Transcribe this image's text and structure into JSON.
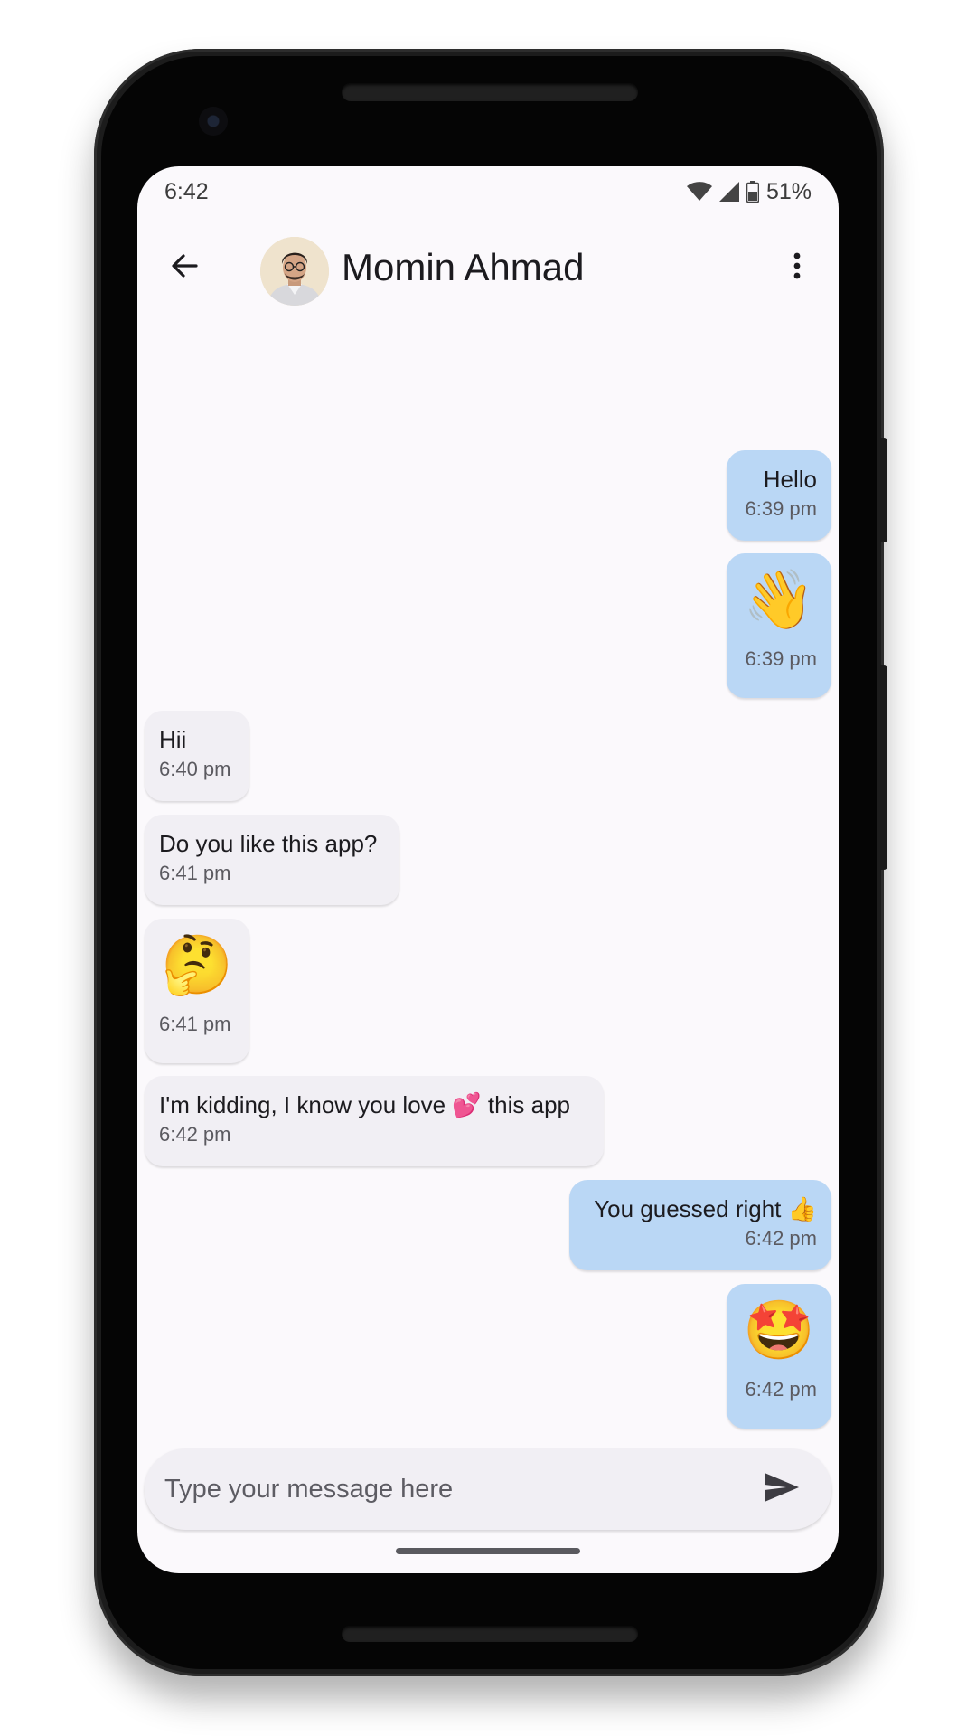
{
  "status_bar": {
    "time": "6:42",
    "battery": "51%",
    "icons": [
      "wifi-icon",
      "signal-icon",
      "battery-icon"
    ]
  },
  "app_bar": {
    "back_icon": "arrow-left-icon",
    "contact_name": "Momin Ahmad",
    "menu_icon": "more-vert-icon"
  },
  "messages": [
    {
      "direction": "sent",
      "text": "Hello",
      "time": "6:39 pm"
    },
    {
      "direction": "sent",
      "emoji": "👋",
      "time": "6:39 pm"
    },
    {
      "direction": "received",
      "text": "Hii",
      "time": "6:40 pm"
    },
    {
      "direction": "received",
      "text": "Do you like this app?",
      "time": "6:41 pm"
    },
    {
      "direction": "received",
      "emoji": "🤔",
      "time": "6:41 pm"
    },
    {
      "direction": "received",
      "text": "I'm kidding, I know you love 💕 this app",
      "time": "6:42 pm"
    },
    {
      "direction": "sent",
      "text": "You guessed right 👍",
      "time": "6:42 pm"
    },
    {
      "direction": "sent",
      "emoji": "🤩",
      "time": "6:42 pm"
    }
  ],
  "composer": {
    "placeholder": "Type your message here",
    "value": "",
    "send_icon": "send-icon"
  },
  "colors": {
    "screen_background": "#fbf9fc",
    "sent_bubble": "#bad7f5",
    "received_bubble": "#f1eff4",
    "text": "#1c1b1f",
    "timestamp": "#5b5a60"
  }
}
